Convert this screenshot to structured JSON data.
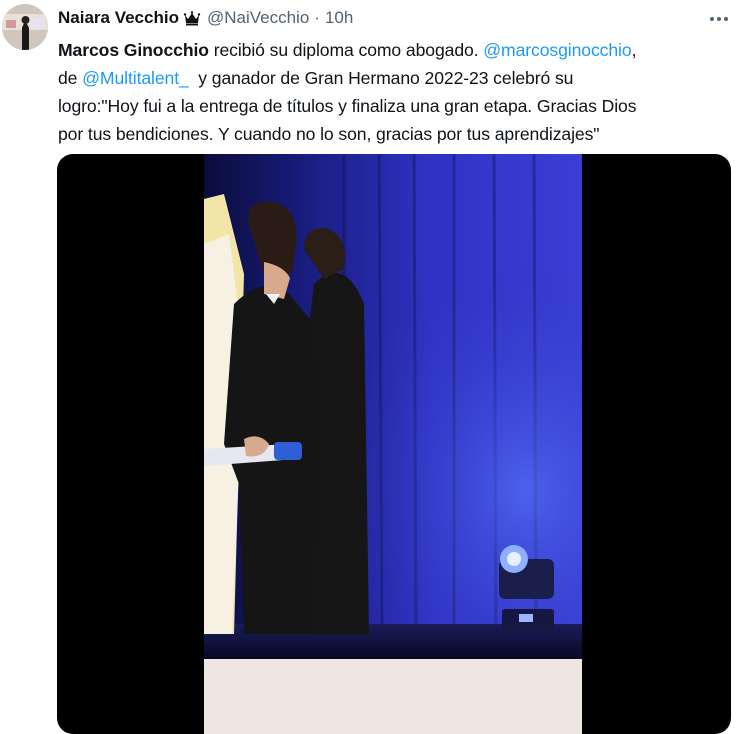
{
  "tweet": {
    "author_name": "Naiara Vecchio",
    "author_badge": "crown-emoji",
    "handle": "@NaiVecchio",
    "separator": "·",
    "timestamp": "10h",
    "more_icon": "more-icon",
    "text": {
      "line1": {
        "bold": "Marcos Ginocchio",
        "middle": " recibió su diploma como abogado. ",
        "mention": "@marcosginocchio",
        "end": ","
      },
      "line2": {
        "start": "de ",
        "mention": "@Multitalent_",
        "end": "  y ganador de Gran Hermano 2022-23 celebró su"
      },
      "line3": "logro:\"Hoy fui a la entrega de títulos y finaliza una gran etapa. Gracias Dios",
      "line4": "por tus bendiciones. Y cuando no lo son, gracias por tus aprendizajes\""
    },
    "media": {
      "type": "video",
      "description_icon": "video-still"
    }
  },
  "colors": {
    "text": "#0f1419",
    "secondary": "#536471",
    "link": "#1d9bf0",
    "stage_blue": "#2a2fb8"
  }
}
